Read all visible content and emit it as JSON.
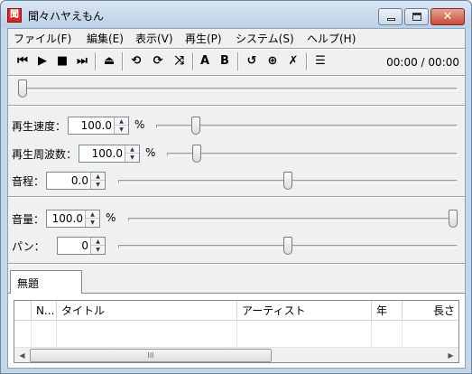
{
  "window": {
    "title": "聞々ハヤえもん",
    "app_icon_glyph": "聞"
  },
  "caption": {
    "minimize_icon": "minimize-icon",
    "maximize_icon": "maximize-icon",
    "close_glyph": "✕"
  },
  "menu": [
    "ファイル(F)",
    "編集(E)",
    "表示(V)",
    "再生(P)",
    "システム(S)",
    "ヘルプ(H)"
  ],
  "toolbar": {
    "buttons": [
      {
        "name": "previous-button",
        "glyph": "⏮"
      },
      {
        "name": "play-button",
        "glyph": "▶"
      },
      {
        "name": "stop-button",
        "glyph": "■"
      },
      {
        "name": "next-button",
        "glyph": "⏭"
      },
      {
        "name": "eject-button",
        "glyph": "⏏"
      },
      {
        "name": "repeat-one-button",
        "glyph": "⟲"
      },
      {
        "name": "repeat-all-button",
        "glyph": "⟳"
      },
      {
        "name": "random-button",
        "glyph": "⤨"
      },
      {
        "name": "ab-loop-a-button",
        "glyph": "A"
      },
      {
        "name": "ab-loop-b-button",
        "glyph": "B"
      },
      {
        "name": "marker-loop-button",
        "glyph": "↺"
      },
      {
        "name": "add-marker-button",
        "glyph": "⊕"
      },
      {
        "name": "delete-marker-button",
        "glyph": "✗"
      },
      {
        "name": "playlist-toggle-button",
        "glyph": "☰"
      }
    ],
    "time": "00:00 / 00:00"
  },
  "position_slider": {
    "value": 0
  },
  "controls": {
    "speed": {
      "label": "再生速度：",
      "value": "100.0",
      "unit": "%",
      "slider": 0.12
    },
    "frequency": {
      "label": "再生周波数：",
      "value": "100.0",
      "unit": "%",
      "slider": 0.09
    },
    "pitch": {
      "label": "音程：",
      "value": "0.0",
      "unit": "",
      "slider": 0.5
    },
    "volume": {
      "label": "音量：",
      "value": "100.0",
      "unit": "%",
      "slider": 1.0
    },
    "pan": {
      "label": "パン：",
      "value": "0",
      "unit": "",
      "slider": 0.5
    }
  },
  "spin_arrows": {
    "up": "▲",
    "down": "▼"
  },
  "playlist": {
    "tab": "無題",
    "columns": [
      "N...",
      "タイトル",
      "アーティスト",
      "年",
      "長さ"
    ],
    "rows": [],
    "scroll": {
      "left": "◀",
      "right": "▶",
      "grip": "III"
    }
  }
}
